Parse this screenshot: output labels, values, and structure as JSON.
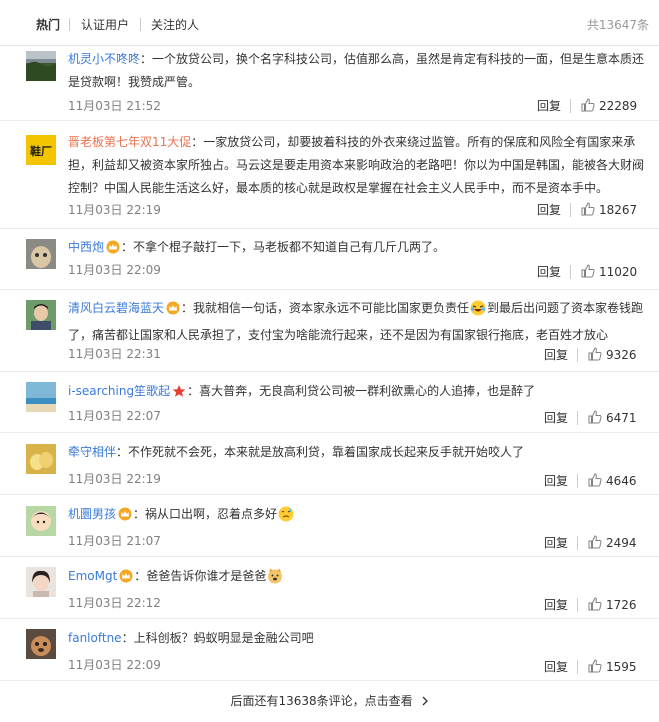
{
  "tabs": [
    {
      "label": "热门"
    },
    {
      "label": "认证用户"
    },
    {
      "label": "关注的人"
    }
  ],
  "total_count": "共13647条",
  "reply_label": "回复",
  "more_link": "后面还有13638条评论，点击查看",
  "comments": [
    {
      "user": "机灵小不咚咚",
      "text": "一个放贷公司，换个名字科技公司，估值那么高，虽然是肯定有科技的一面，但是生意本质还是贷款啊！我赞成严管。",
      "time": "11月03日 21:52",
      "likes": "22289"
    },
    {
      "user": "晋老板第七年双11大促",
      "text": "一家放贷公司，却要披着科技的外衣来绕过监管。所有的保底和风险全有国家来承担，利益却又被资本家所独占。马云这是要走用资本来影响政治的老路吧！你以为中国是韩国，能被各大财阀控制？中国人民能生活这么好，最本质的核心就是政权是掌握在社会主义人民手中，而不是资本手中。",
      "time": "11月03日 22:19",
      "likes": "18267"
    },
    {
      "user": "中西炮",
      "text": "不拿个棍子敲打一下，马老板都不知道自己有几斤几两了。",
      "time": "11月03日 22:09",
      "likes": "11020"
    },
    {
      "user": "清风白云碧海蓝天",
      "text_a": "我就相信一句话，资本家永远不可能比国家更负责任",
      "text_b": "到最后出问题了资本家卷钱跑了，痛苦都让国家和人民承担了，支付宝为啥能流行起来，还不是因为有国家银行拖底，老百姓才放心",
      "time": "11月03日 22:31",
      "likes": "9326"
    },
    {
      "user": "i-searching笙歌起",
      "text": "喜大普奔，无良高利贷公司被一群利欲熏心的人追捧，也是醉了",
      "time": "11月03日 22:07",
      "likes": "6471"
    },
    {
      "user": "牵守相伴",
      "text": "不作死就不会死，本来就是放高利贷，靠着国家成长起来反手就开始咬人了",
      "time": "11月03日 22:19",
      "likes": "4646"
    },
    {
      "user": "机圜男孩",
      "text": "祸从口出啊，忍着点多好",
      "time": "11月03日 21:07",
      "likes": "2494"
    },
    {
      "user": "EmoMgt",
      "text": "爸爸告诉你谁才是爸爸",
      "time": "11月03日 22:12",
      "likes": "1726"
    },
    {
      "user": "fanloftne",
      "text": "上科创板？蚂蚁明显是金融公司吧",
      "time": "11月03日 22:09",
      "likes": "1595"
    }
  ],
  "icons": {
    "crown_badge": "crown-badge-icon",
    "star_badge": "star-badge-icon",
    "like": "thumb-up-icon",
    "chevron": "chevron-right-icon"
  },
  "colors": {
    "username_orange": "#eb7350",
    "username_blue": "#3a7ad8",
    "time_gray": "#808080",
    "divider": "#ececec"
  }
}
